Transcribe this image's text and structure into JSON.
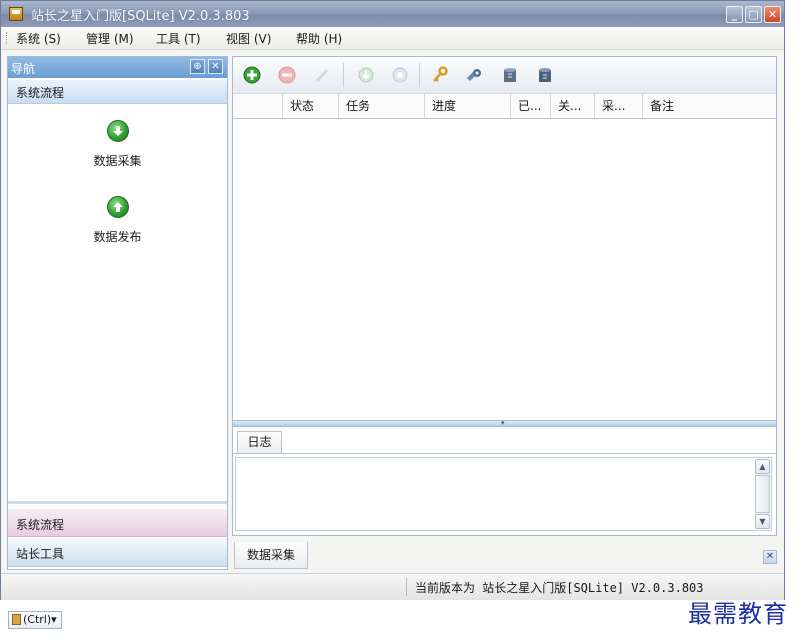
{
  "window": {
    "title": "站长之星入门版[SQLite] V2.0.3.803"
  },
  "menubar": {
    "items": [
      "系统 (S)",
      "管理 (M)",
      "工具 (T)",
      "视图 (V)",
      "帮助 (H)"
    ]
  },
  "navigation": {
    "header": "导航",
    "pin_glyph": "⊕",
    "close_glyph": "✕",
    "active_section": "系统流程",
    "tasks": [
      {
        "label": "数据采集",
        "icon": "arrow-down-circle-icon"
      },
      {
        "label": "数据发布",
        "icon": "arrow-up-circle-icon"
      }
    ],
    "bottom_sections": [
      "系统流程",
      "站长工具"
    ]
  },
  "toolbar": {
    "icons": [
      "add-icon",
      "remove-icon",
      "edit-icon",
      "start-icon",
      "stop-icon",
      "key-icon",
      "tools-icon",
      "import-db-icon",
      "export-db-icon"
    ]
  },
  "task_grid": {
    "columns": [
      "",
      "状态",
      "任务",
      "进度",
      "已...",
      "关...",
      "采...",
      "备注"
    ]
  },
  "log": {
    "tab_label": "日志",
    "content": ""
  },
  "document_tabs": {
    "active": "数据采集",
    "close_glyph": "✕"
  },
  "statusbar": {
    "text": "当前版本为 站长之星入门版[SQLite] V2.0.3.803"
  },
  "clipboard_hint": "(Ctrl)▾",
  "watermark": "最需教育",
  "colors": {
    "title_bar": "#8b9bb8",
    "nav_header": "#6d9dd2",
    "accent_green": "#2e9a2e",
    "watermark": "#1d2fa3"
  }
}
